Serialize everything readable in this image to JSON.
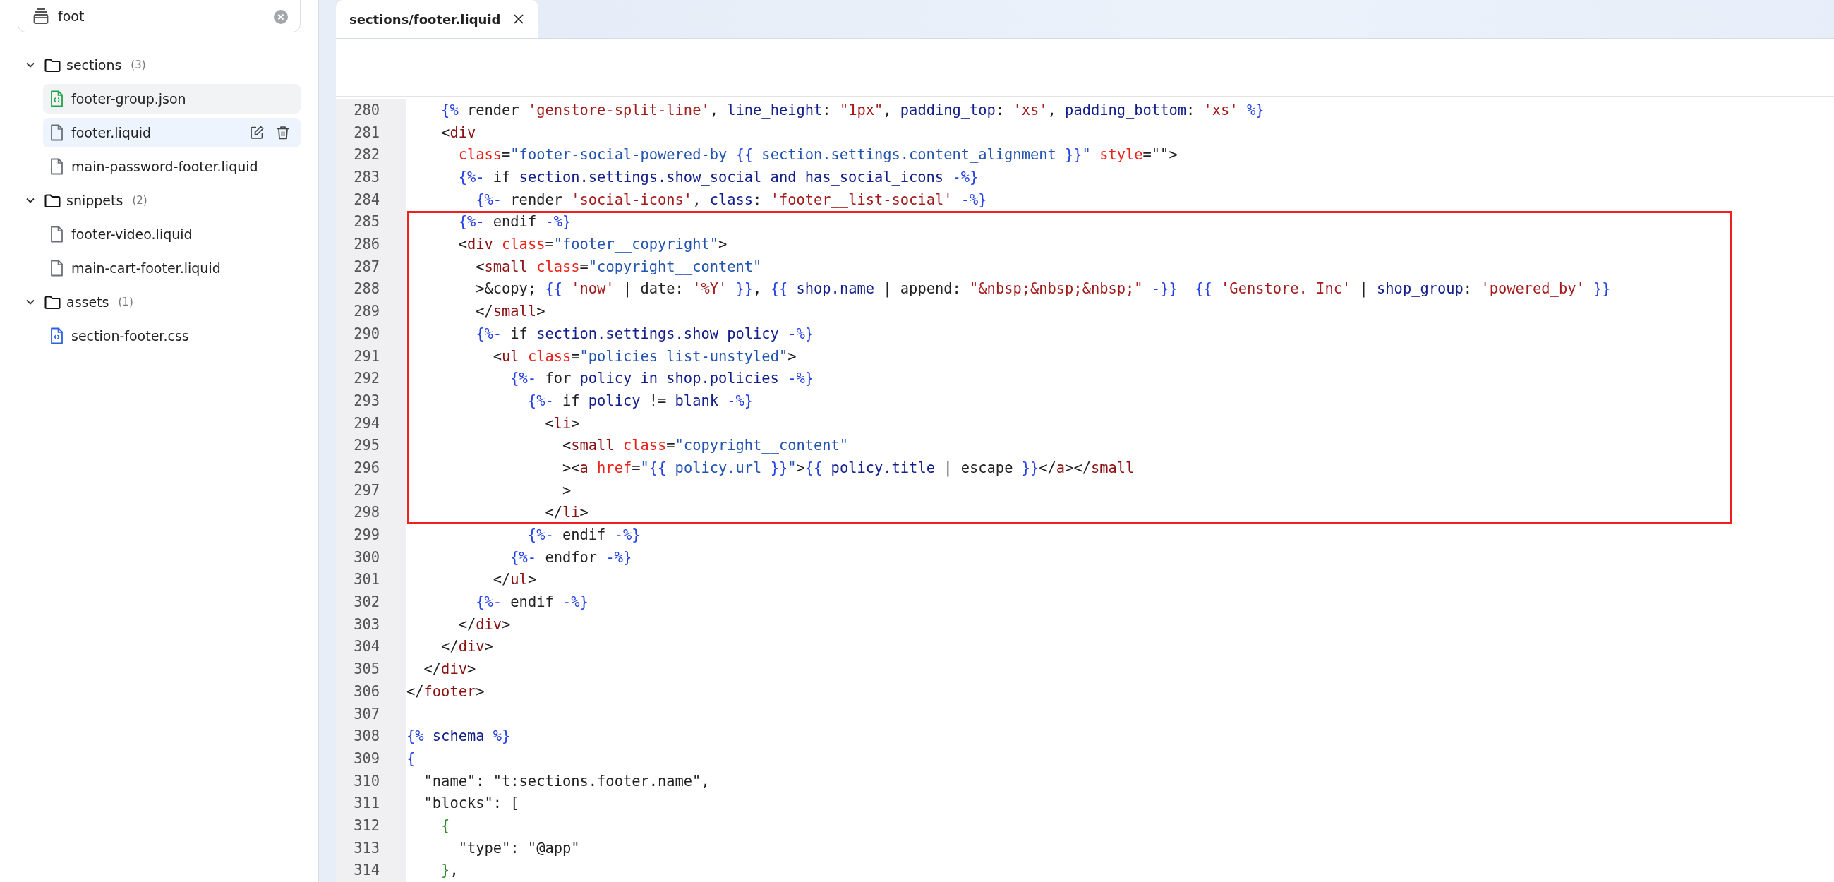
{
  "sidebar": {
    "search": {
      "value": "foot"
    },
    "tree": [
      {
        "name": "sections",
        "count": "(3)",
        "expanded": true,
        "children": [
          {
            "name": "footer-group.json",
            "kind": "json",
            "hovered": true,
            "selected": false
          },
          {
            "name": "footer.liquid",
            "kind": "liquid",
            "hovered": false,
            "selected": true
          },
          {
            "name": "main-password-footer.liquid",
            "kind": "liquid",
            "hovered": false,
            "selected": false
          }
        ]
      },
      {
        "name": "snippets",
        "count": "(2)",
        "expanded": true,
        "children": [
          {
            "name": "footer-video.liquid",
            "kind": "liquid",
            "hovered": false,
            "selected": false
          },
          {
            "name": "main-cart-footer.liquid",
            "kind": "liquid",
            "hovered": false,
            "selected": false
          }
        ]
      },
      {
        "name": "assets",
        "count": "(1)",
        "expanded": true,
        "children": [
          {
            "name": "section-footer.css",
            "kind": "css",
            "hovered": false,
            "selected": false
          }
        ]
      }
    ]
  },
  "tabs": [
    {
      "label": "sections/footer.liquid",
      "selected": true
    }
  ],
  "editor": {
    "segments": [
      {
        "boxed": false,
        "lines": [
          {
            "number": "280",
            "tokens": [
              {
                "kind": "delim",
                "text": "    {%"
              },
              {
                "kind": "plain",
                "text": " render "
              },
              {
                "kind": "str",
                "text": "'genstore-split-line'"
              },
              {
                "kind": "plain",
                "text": ", "
              },
              {
                "kind": "var",
                "text": "line_height"
              },
              {
                "kind": "plain",
                "text": ": "
              },
              {
                "kind": "str",
                "text": "\"1px\""
              },
              {
                "kind": "plain",
                "text": ", "
              },
              {
                "kind": "var",
                "text": "padding_top"
              },
              {
                "kind": "plain",
                "text": ": "
              },
              {
                "kind": "str",
                "text": "'xs'"
              },
              {
                "kind": "plain",
                "text": ", "
              },
              {
                "kind": "var",
                "text": "padding_bottom"
              },
              {
                "kind": "plain",
                "text": ": "
              },
              {
                "kind": "str",
                "text": "'xs'"
              },
              {
                "kind": "delim",
                "text": " %}"
              }
            ]
          },
          {
            "number": "281",
            "tokens": [
              {
                "kind": "plain",
                "text": "    <"
              },
              {
                "kind": "tag",
                "text": "div"
              }
            ]
          },
          {
            "number": "282",
            "tokens": [
              {
                "kind": "attr",
                "text": "      class"
              },
              {
                "kind": "plain",
                "text": "="
              },
              {
                "kind": "attrval",
                "text": "\"footer-social-powered-by "
              },
              {
                "kind": "delim",
                "text": "{{"
              },
              {
                "kind": "attrval",
                "text": " section.settings.content_alignment "
              },
              {
                "kind": "delim",
                "text": "}}"
              },
              {
                "kind": "attrval",
                "text": "\""
              },
              {
                "kind": "attr",
                "text": " style"
              },
              {
                "kind": "plain",
                "text": "=\"\">"
              }
            ]
          },
          {
            "number": "283",
            "tokens": [
              {
                "kind": "delim",
                "text": "      {%-"
              },
              {
                "kind": "plain",
                "text": " if "
              },
              {
                "kind": "var",
                "text": "section.settings.show_social and has_social_icons"
              },
              {
                "kind": "delim",
                "text": " -%}"
              }
            ]
          },
          {
            "number": "284",
            "tokens": [
              {
                "kind": "delim",
                "text": "        {%-"
              },
              {
                "kind": "plain",
                "text": " render "
              },
              {
                "kind": "str",
                "text": "'social-icons'"
              },
              {
                "kind": "plain",
                "text": ", "
              },
              {
                "kind": "var",
                "text": "class"
              },
              {
                "kind": "plain",
                "text": ": "
              },
              {
                "kind": "str",
                "text": "'footer__list-social'"
              },
              {
                "kind": "delim",
                "text": " -%}"
              }
            ]
          }
        ]
      },
      {
        "boxed": true,
        "lines": [
          {
            "number": "285",
            "tokens": [
              {
                "kind": "delim",
                "text": "      {%-"
              },
              {
                "kind": "plain",
                "text": " endif "
              },
              {
                "kind": "delim",
                "text": "-%}"
              }
            ]
          },
          {
            "number": "286",
            "tokens": [
              {
                "kind": "plain",
                "text": "      <"
              },
              {
                "kind": "tag",
                "text": "div"
              },
              {
                "kind": "attr",
                "text": " class"
              },
              {
                "kind": "plain",
                "text": "="
              },
              {
                "kind": "attrval",
                "text": "\"footer__copyright\""
              },
              {
                "kind": "plain",
                "text": ">"
              }
            ]
          },
          {
            "number": "287",
            "tokens": [
              {
                "kind": "plain",
                "text": "        <"
              },
              {
                "kind": "tag",
                "text": "small"
              },
              {
                "kind": "attr",
                "text": " class"
              },
              {
                "kind": "plain",
                "text": "="
              },
              {
                "kind": "attrval",
                "text": "\"copyright__content\""
              }
            ]
          },
          {
            "number": "288",
            "tokens": [
              {
                "kind": "plain",
                "text": "        >&copy; "
              },
              {
                "kind": "delim",
                "text": "{{"
              },
              {
                "kind": "str",
                "text": " 'now'"
              },
              {
                "kind": "plain",
                "text": " | date: "
              },
              {
                "kind": "str",
                "text": "'%Y'"
              },
              {
                "kind": "delim",
                "text": " }}"
              },
              {
                "kind": "plain",
                "text": ", "
              },
              {
                "kind": "delim",
                "text": "{{"
              },
              {
                "kind": "var",
                "text": " shop.name"
              },
              {
                "kind": "plain",
                "text": " | append: "
              },
              {
                "kind": "str",
                "text": "\"&nbsp;&nbsp;&nbsp;\""
              },
              {
                "kind": "delim",
                "text": " -}}"
              },
              {
                "kind": "delim",
                "text": "  {{"
              },
              {
                "kind": "str",
                "text": " 'Genstore. Inc'"
              },
              {
                "kind": "plain",
                "text": " | "
              },
              {
                "kind": "var",
                "text": "shop_group"
              },
              {
                "kind": "plain",
                "text": ": "
              },
              {
                "kind": "str",
                "text": "'powered_by'"
              },
              {
                "kind": "delim",
                "text": " }}"
              }
            ]
          },
          {
            "number": "289",
            "tokens": [
              {
                "kind": "plain",
                "text": "        </"
              },
              {
                "kind": "tag",
                "text": "small"
              },
              {
                "kind": "plain",
                "text": ">"
              }
            ]
          },
          {
            "number": "290",
            "tokens": [
              {
                "kind": "delim",
                "text": "        {%-"
              },
              {
                "kind": "plain",
                "text": " if "
              },
              {
                "kind": "var",
                "text": "section.settings.show_policy"
              },
              {
                "kind": "delim",
                "text": " -%}"
              }
            ]
          },
          {
            "number": "291",
            "tokens": [
              {
                "kind": "plain",
                "text": "          <"
              },
              {
                "kind": "tag",
                "text": "ul"
              },
              {
                "kind": "attr",
                "text": " class"
              },
              {
                "kind": "plain",
                "text": "="
              },
              {
                "kind": "attrval",
                "text": "\"policies list-unstyled\""
              },
              {
                "kind": "plain",
                "text": ">"
              }
            ]
          },
          {
            "number": "292",
            "tokens": [
              {
                "kind": "delim",
                "text": "            {%-"
              },
              {
                "kind": "plain",
                "text": " for "
              },
              {
                "kind": "var",
                "text": "policy in shop.policies"
              },
              {
                "kind": "delim",
                "text": " -%}"
              }
            ]
          },
          {
            "number": "293",
            "tokens": [
              {
                "kind": "delim",
                "text": "              {%-"
              },
              {
                "kind": "plain",
                "text": " if "
              },
              {
                "kind": "var",
                "text": "policy"
              },
              {
                "kind": "plain",
                "text": " != "
              },
              {
                "kind": "var",
                "text": "blank"
              },
              {
                "kind": "delim",
                "text": " -%}"
              }
            ]
          },
          {
            "number": "294",
            "tokens": [
              {
                "kind": "plain",
                "text": "                <"
              },
              {
                "kind": "tag",
                "text": "li"
              },
              {
                "kind": "plain",
                "text": ">"
              }
            ]
          },
          {
            "number": "295",
            "tokens": [
              {
                "kind": "plain",
                "text": "                  <"
              },
              {
                "kind": "tag",
                "text": "small"
              },
              {
                "kind": "attr",
                "text": " class"
              },
              {
                "kind": "plain",
                "text": "="
              },
              {
                "kind": "attrval",
                "text": "\"copyright__content\""
              }
            ]
          },
          {
            "number": "296",
            "tokens": [
              {
                "kind": "plain",
                "text": "                  ><"
              },
              {
                "kind": "tag",
                "text": "a"
              },
              {
                "kind": "attr",
                "text": " href"
              },
              {
                "kind": "plain",
                "text": "="
              },
              {
                "kind": "attrval",
                "text": "\""
              },
              {
                "kind": "delim",
                "text": "{{"
              },
              {
                "kind": "attrval",
                "text": " policy.url "
              },
              {
                "kind": "delim",
                "text": "}}"
              },
              {
                "kind": "attrval",
                "text": "\""
              },
              {
                "kind": "plain",
                "text": ">"
              },
              {
                "kind": "delim",
                "text": "{{"
              },
              {
                "kind": "var",
                "text": " policy.title"
              },
              {
                "kind": "plain",
                "text": " | escape "
              },
              {
                "kind": "delim",
                "text": "}}"
              },
              {
                "kind": "plain",
                "text": "</"
              },
              {
                "kind": "tag",
                "text": "a"
              },
              {
                "kind": "plain",
                "text": "></"
              },
              {
                "kind": "tag",
                "text": "small"
              }
            ]
          },
          {
            "number": "297",
            "tokens": [
              {
                "kind": "plain",
                "text": "                  >"
              }
            ]
          },
          {
            "number": "298",
            "tokens": [
              {
                "kind": "plain",
                "text": "                </"
              },
              {
                "kind": "tag",
                "text": "li"
              },
              {
                "kind": "plain",
                "text": ">"
              }
            ]
          }
        ]
      },
      {
        "boxed": false,
        "lines": [
          {
            "number": "299",
            "tokens": [
              {
                "kind": "delim",
                "text": "              {%-"
              },
              {
                "kind": "plain",
                "text": " endif "
              },
              {
                "kind": "delim",
                "text": "-%}"
              }
            ]
          },
          {
            "number": "300",
            "tokens": [
              {
                "kind": "delim",
                "text": "            {%-"
              },
              {
                "kind": "plain",
                "text": " endfor "
              },
              {
                "kind": "delim",
                "text": "-%}"
              }
            ]
          },
          {
            "number": "301",
            "tokens": [
              {
                "kind": "plain",
                "text": "          </"
              },
              {
                "kind": "tag",
                "text": "ul"
              },
              {
                "kind": "plain",
                "text": ">"
              }
            ]
          },
          {
            "number": "302",
            "tokens": [
              {
                "kind": "delim",
                "text": "        {%-"
              },
              {
                "kind": "plain",
                "text": " endif "
              },
              {
                "kind": "delim",
                "text": "-%}"
              }
            ]
          },
          {
            "number": "303",
            "tokens": [
              {
                "kind": "plain",
                "text": "      </"
              },
              {
                "kind": "tag",
                "text": "div"
              },
              {
                "kind": "plain",
                "text": ">"
              }
            ]
          },
          {
            "number": "304",
            "tokens": [
              {
                "kind": "plain",
                "text": "    </"
              },
              {
                "kind": "tag",
                "text": "div"
              },
              {
                "kind": "plain",
                "text": ">"
              }
            ]
          },
          {
            "number": "305",
            "tokens": [
              {
                "kind": "plain",
                "text": "  </"
              },
              {
                "kind": "tag",
                "text": "div"
              },
              {
                "kind": "plain",
                "text": ">"
              }
            ]
          },
          {
            "number": "306",
            "tokens": [
              {
                "kind": "plain",
                "text": "</"
              },
              {
                "kind": "tag",
                "text": "footer"
              },
              {
                "kind": "plain",
                "text": ">"
              }
            ]
          },
          {
            "number": "307"
          },
          {
            "number": "308",
            "tokens": [
              {
                "kind": "delim",
                "text": "{%"
              },
              {
                "kind": "var",
                "text": " schema "
              },
              {
                "kind": "delim",
                "text": "%}"
              }
            ]
          },
          {
            "number": "309",
            "tokens": [
              {
                "kind": "delim",
                "text": "{"
              }
            ]
          },
          {
            "number": "310",
            "tokens": [
              {
                "kind": "plain",
                "text": "  \"name\": \"t:sections.footer.name\","
              }
            ]
          },
          {
            "number": "311",
            "tokens": [
              {
                "kind": "plain",
                "text": "  \"blocks\": ["
              }
            ]
          },
          {
            "number": "312",
            "tokens": [
              {
                "kind": "brace",
                "text": "    {"
              }
            ]
          },
          {
            "number": "313",
            "tokens": [
              {
                "kind": "plain",
                "text": "      \"type\": \"@app\""
              }
            ]
          },
          {
            "number": "314",
            "tokens": [
              {
                "kind": "brace",
                "text": "    }"
              },
              {
                "kind": "plain",
                "text": ","
              }
            ]
          }
        ]
      }
    ]
  }
}
